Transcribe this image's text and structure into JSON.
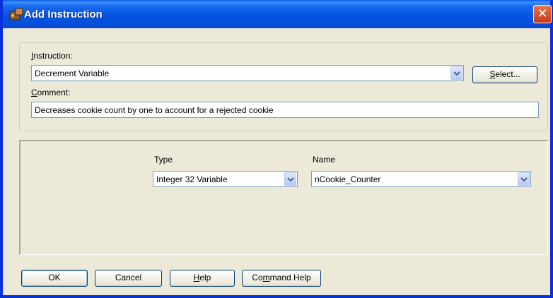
{
  "window": {
    "title": "Add Instruction",
    "close_label": "✕"
  },
  "instruction": {
    "label_u": "I",
    "label_rest": "nstruction:",
    "value": "Decrement Variable",
    "select_button_u": "S",
    "select_button_rest": "elect..."
  },
  "comment": {
    "label_u": "C",
    "label_rest": "omment:",
    "value": "Decreases cookie count by one to account for a rejected cookie"
  },
  "params": {
    "type_label": "Type",
    "type_value": "Integer 32 Variable",
    "name_label": "Name",
    "name_value": "nCookie_Counter"
  },
  "buttons": {
    "ok": "OK",
    "cancel": "Cancel",
    "help_u": "H",
    "help_rest": "elp",
    "command_help_pre": "Co",
    "command_help_u": "m",
    "command_help_post": "mand Help"
  },
  "colors": {
    "titlebar": "#0553e2",
    "window_bg": "#ece9d8",
    "frame": "#0831d9"
  }
}
